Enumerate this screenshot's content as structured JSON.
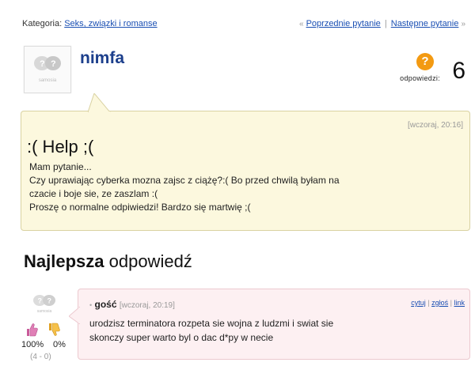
{
  "breadcrumb": {
    "prefix": "Kategoria:",
    "category": "Seks, związki i romanse"
  },
  "nav": {
    "prev_arrow": "«",
    "prev": "Poprzednie pytanie",
    "separator": "|",
    "next": "Następne pytanie",
    "next_arrow": "»"
  },
  "question": {
    "author": "nimfa",
    "avatar_label": "samosia",
    "answers_label": "odpowiedzi:",
    "answers_count": "6",
    "answers_icon": "question-badge-icon",
    "time": "[wczoraj, 20:16]",
    "title": ":( Help ;(",
    "body": [
      "Mam pytanie...",
      "Czy uprawiając cyberka mozna zajsc z ciążę?:( Bo przed chwilą byłam na",
      "czacie i boje sie, ze zaszlam :(",
      "Proszę o normalne odpiwiedzi! Bardzo się martwię ;("
    ],
    "colors": {
      "bg": "#fcf8de",
      "border": "#d9d2a2"
    }
  },
  "best": {
    "heading_bold": "Najlepsza",
    "heading_rest": " odpowiedź"
  },
  "answer": {
    "bullet": "•",
    "author": "gość",
    "time": "[wczoraj, 20:19]",
    "links": [
      "cytuj",
      "zgłoś",
      "link"
    ],
    "link_sep": "|",
    "avatar_label": "samosia",
    "body": [
      "urodzisz terminatora rozpeta sie wojna z ludzmi i swiat sie",
      "skonczy super warto byl o dac d*py w necie"
    ],
    "votes": {
      "up_pct": "100%",
      "down_pct": "0%",
      "tally": "(4 - 0)"
    },
    "colors": {
      "bg": "#fdf0f2",
      "border": "#ecc9cf"
    }
  }
}
